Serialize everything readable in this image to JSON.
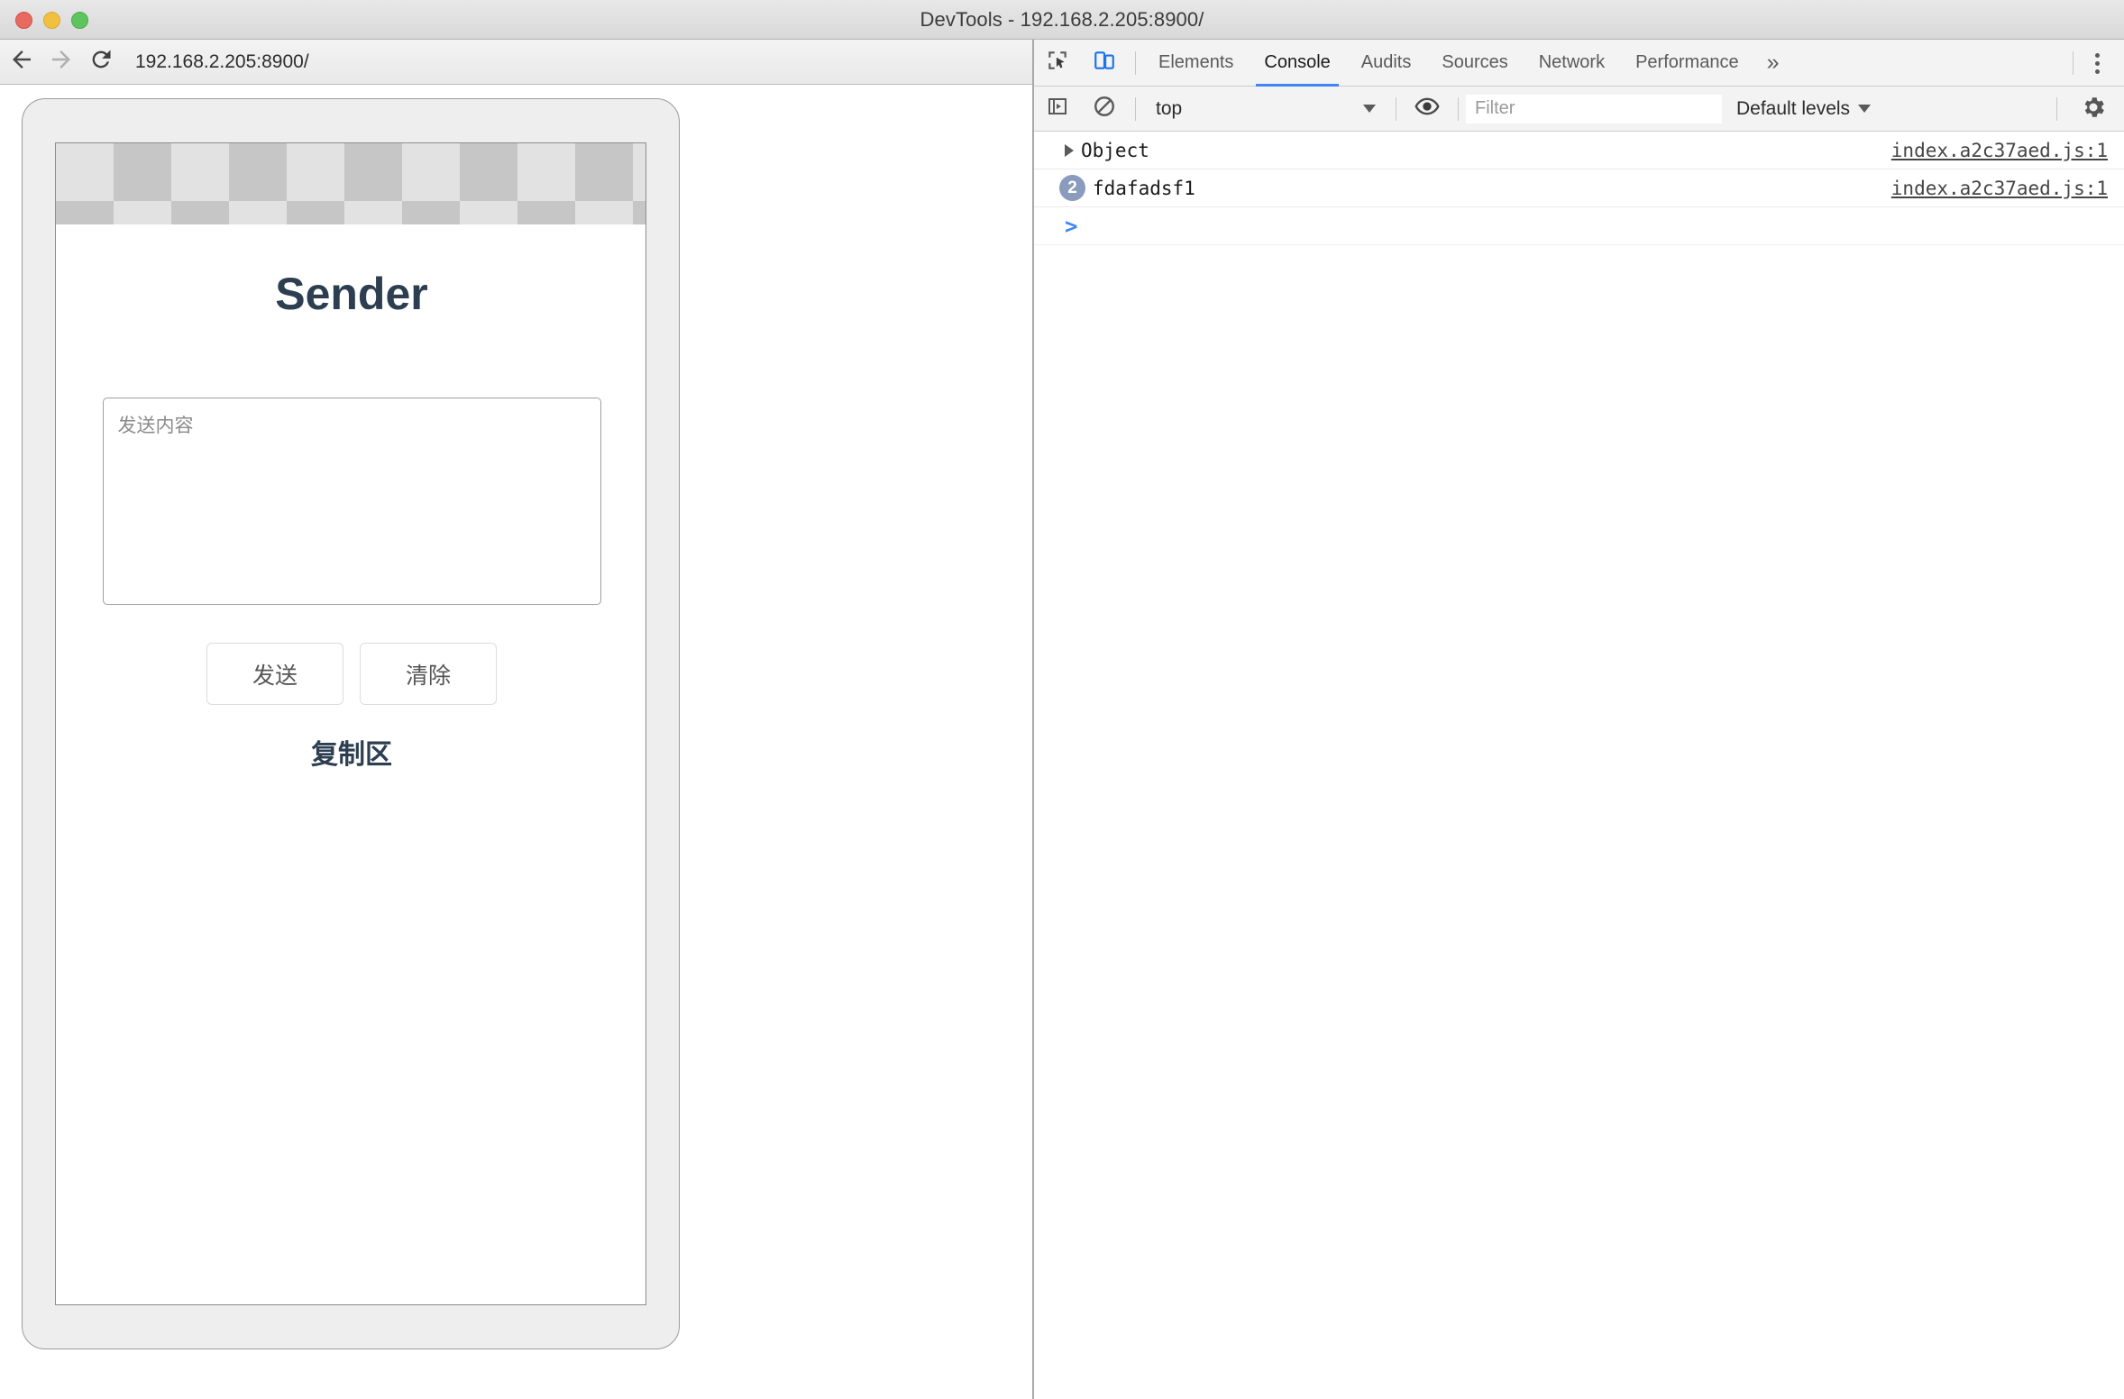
{
  "window": {
    "title": "DevTools - 192.168.2.205:8900/",
    "traffic_lights": [
      "close-button",
      "minimize-button",
      "maximize-button"
    ]
  },
  "browser": {
    "back_icon": "back-arrow-icon",
    "forward_icon": "forward-arrow-icon",
    "reload_icon": "reload-icon",
    "url": "192.168.2.205:8900/"
  },
  "page": {
    "app_title": "Sender",
    "textarea_placeholder": "发送内容",
    "textarea_value": "",
    "buttons": [
      {
        "label": "发送",
        "name": "send-button"
      },
      {
        "label": "清除",
        "name": "clear-button"
      }
    ],
    "copy_area_label": "复制区"
  },
  "devtools": {
    "inspect_icon": "inspect-element-icon",
    "device_toolbar_icon": "device-toolbar-icon",
    "device_toolbar_active_color": "#1a73e8",
    "tabs": [
      {
        "label": "Elements",
        "active": false
      },
      {
        "label": "Console",
        "active": true
      },
      {
        "label": "Audits",
        "active": false
      },
      {
        "label": "Sources",
        "active": false
      },
      {
        "label": "Network",
        "active": false
      },
      {
        "label": "Performance",
        "active": false
      }
    ],
    "more_tabs_label": "»",
    "menu_icon": "kebab-menu-icon",
    "active_tab_underline_color": "#4285f4",
    "console_toolbar": {
      "sidebar_toggle_icon": "console-sidebar-toggle-icon",
      "clear_console_icon": "clear-console-icon",
      "context_selected": "top",
      "context_caret": "chevron-down-icon",
      "eye_icon": "live-expression-eye-icon",
      "filter_placeholder": "Filter",
      "filter_value": "",
      "levels_label": "Default levels",
      "levels_caret": "chevron-down-icon",
      "settings_icon": "settings-gear-icon"
    },
    "messages": [
      {
        "kind": "object",
        "expand_icon": "disclosure-triangle-icon",
        "text": "Object",
        "count": null,
        "source": "index.a2c37aed.js:1"
      },
      {
        "kind": "log",
        "expand_icon": null,
        "text": "fdafadsf1",
        "count": "2",
        "source": "index.a2c37aed.js:1"
      }
    ],
    "prompt_symbol": ">",
    "prompt_value": "",
    "count_badge_color": "#8a9bbd"
  }
}
